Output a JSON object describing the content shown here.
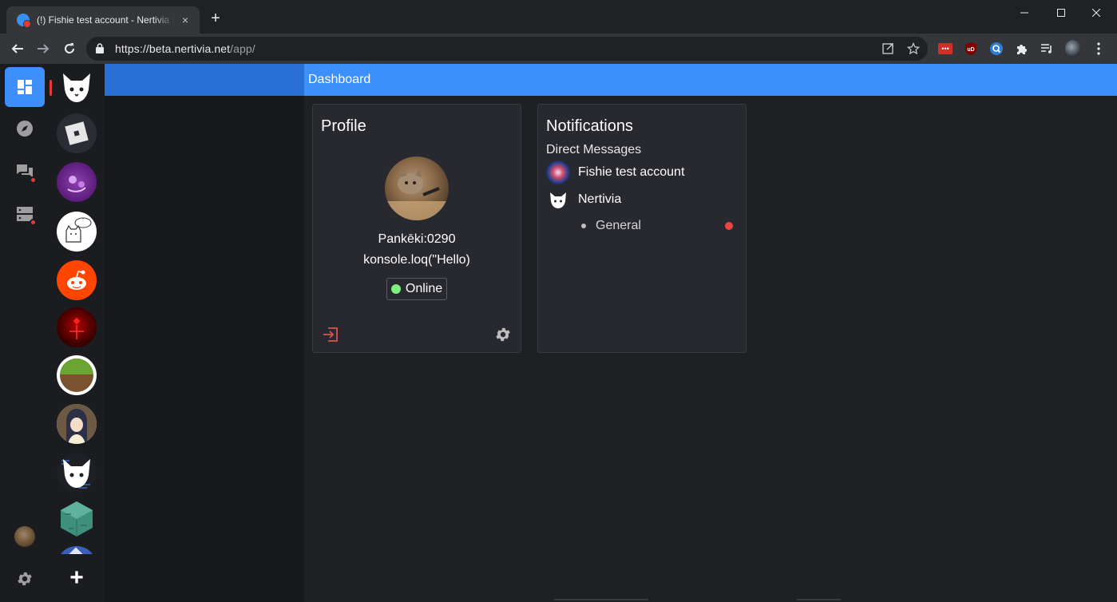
{
  "browser": {
    "tab_title": "(!) Fishie test account - Nertivia Beta",
    "url_host": "https://beta.nertivia.net",
    "url_path": "/app/",
    "new_tab_symbol": "+",
    "tab_close_symbol": "×"
  },
  "extensions": [
    "lastpass-icon",
    "ublock-icon",
    "search-ext-icon",
    "puzzle-icon",
    "media-queue-icon",
    "profile-avatar"
  ],
  "nav_rail": {
    "items": [
      {
        "name": "dashboard-icon",
        "active": true
      },
      {
        "name": "explore-icon",
        "active": false
      },
      {
        "name": "direct-messages-icon",
        "active": false,
        "notification": true
      },
      {
        "name": "servers-icon",
        "active": false,
        "notification": true
      }
    ],
    "bottom": [
      "user-avatar",
      "settings-icon"
    ]
  },
  "server_list": {
    "servers": [
      {
        "name": "nertivia-server",
        "icon": "cat-logo"
      },
      {
        "name": "roblox-server",
        "icon": "roblox-logo"
      },
      {
        "name": "purple-server",
        "icon": "purple-blob"
      },
      {
        "name": "doodle-server",
        "icon": "cat-doodle"
      },
      {
        "name": "reddit-server",
        "icon": "reddit-logo"
      },
      {
        "name": "dark-red-server",
        "icon": "red-abstract"
      },
      {
        "name": "minecraft-server",
        "icon": "grass-block"
      },
      {
        "name": "anime-server",
        "icon": "anime-girl"
      },
      {
        "name": "code-cat-server",
        "icon": "cat-logo-dark"
      },
      {
        "name": "cube-server",
        "icon": "teal-cube"
      }
    ],
    "add_symbol": "+"
  },
  "header": {
    "title": "Dashboard"
  },
  "profile_card": {
    "title": "Profile",
    "username": "Pankēki:0290",
    "custom_status": "konsole.loq(\"Hello)",
    "presence": "Online",
    "presence_color": "#7ef07e",
    "logout_icon": "logout-icon",
    "settings_icon": "gear-icon"
  },
  "notifications_card": {
    "title": "Notifications",
    "section": "Direct Messages",
    "dm": {
      "name": "Fishie test account"
    },
    "server": {
      "name": "Nertivia"
    },
    "channel": {
      "name": "General",
      "unread": true
    }
  },
  "colors": {
    "accent": "#3d8ffc",
    "unread": "#ef4444",
    "online": "#7ef07e"
  }
}
